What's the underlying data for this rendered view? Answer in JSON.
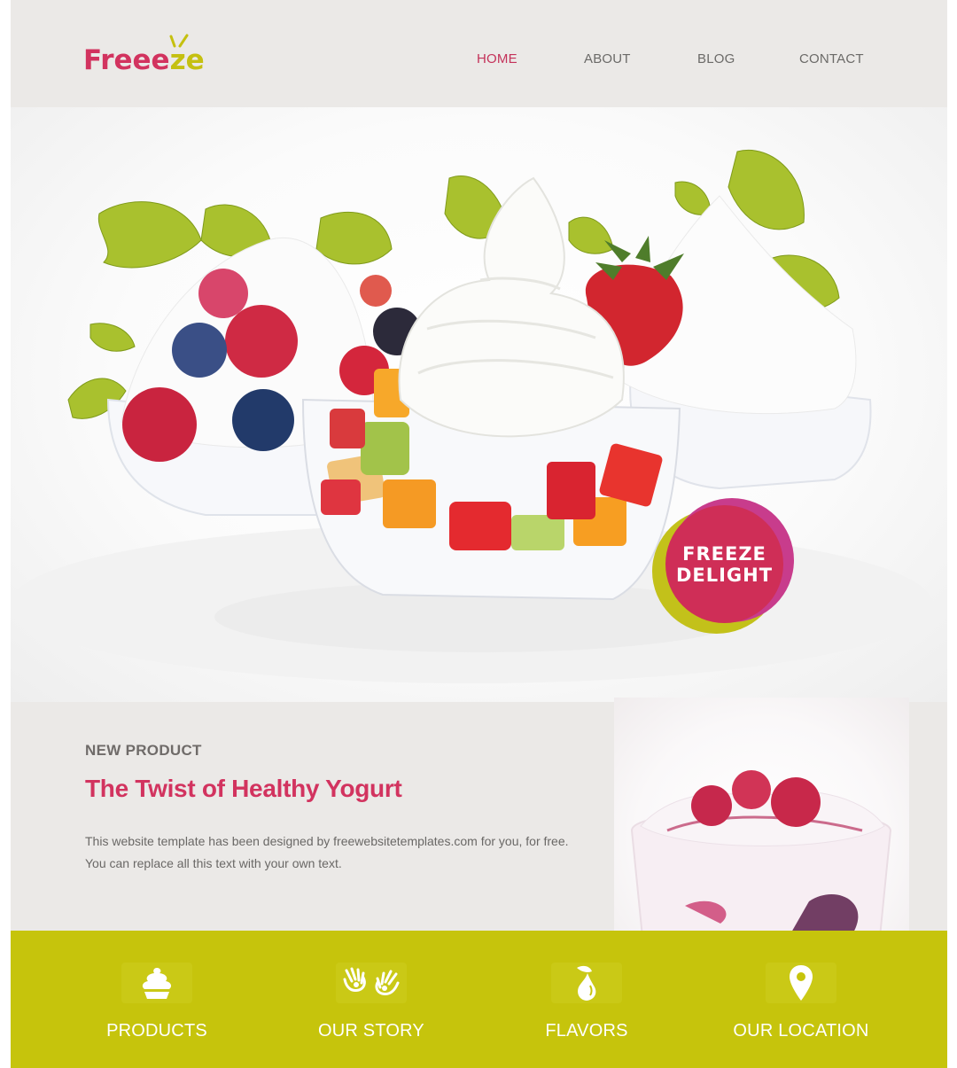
{
  "header": {
    "logo": {
      "text_main": "Freee",
      "text_accent": "ze"
    },
    "nav": [
      {
        "label": "HOME",
        "active": true
      },
      {
        "label": "ABOUT",
        "active": false
      },
      {
        "label": "BLOG",
        "active": false
      },
      {
        "label": "CONTACT",
        "active": false
      }
    ]
  },
  "hero": {
    "badge": {
      "line1": "FREEZE",
      "line2": "DELIGHT"
    }
  },
  "product": {
    "eyebrow": "NEW PRODUCT",
    "title": "The Twist of Healthy Yogurt",
    "body_line1": "This website template has been designed by freewebsitetemplates.com for you, for free.",
    "body_line2": "You can replace all this text with your own text."
  },
  "features": [
    {
      "label": "PRODUCTS",
      "icon": "cupcake-icon"
    },
    {
      "label": "OUR STORY",
      "icon": "hands-icon"
    },
    {
      "label": "FLAVORS",
      "icon": "pear-icon"
    },
    {
      "label": "OUR LOCATION",
      "icon": "location-pin-icon"
    }
  ],
  "colors": {
    "brand_pink": "#d2335f",
    "brand_lime": "#c6c40c",
    "page_bg": "#ebe9e7",
    "nav_text": "#6b6a68"
  }
}
